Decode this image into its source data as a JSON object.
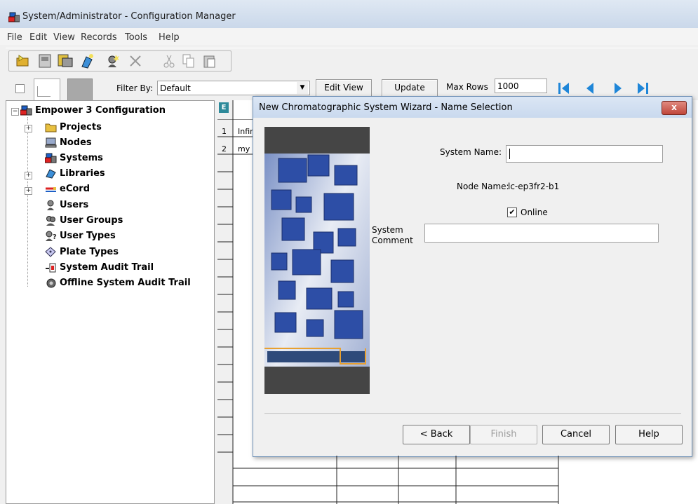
{
  "window": {
    "title": "System/Administrator - Configuration Manager"
  },
  "menu": [
    "File",
    "Edit",
    "View",
    "Records",
    "Tools",
    "Help"
  ],
  "filter_bar": {
    "filter_label": "Filter By:",
    "filter_value": "Default",
    "edit_view_label": "Edit View",
    "update_label": "Update",
    "max_rows_label": "Max Rows",
    "max_rows_value": "1000"
  },
  "tree": {
    "root": "Empower 3 Configuration",
    "items": [
      {
        "label": "Projects",
        "icon": "folder-icon"
      },
      {
        "label": "Nodes",
        "icon": "computer-icon"
      },
      {
        "label": "Systems",
        "icon": "systems-icon"
      },
      {
        "label": "Libraries",
        "icon": "libraries-icon"
      },
      {
        "label": "eCord",
        "icon": "ecord-icon"
      },
      {
        "label": "Users",
        "icon": "user-icon"
      },
      {
        "label": "User Groups",
        "icon": "user-groups-icon"
      },
      {
        "label": "User Types",
        "icon": "user-types-icon"
      },
      {
        "label": "Plate Types",
        "icon": "plate-icon"
      },
      {
        "label": "System Audit Trail",
        "icon": "audit-icon"
      },
      {
        "label": "Offline System Audit Trail",
        "icon": "offline-audit-icon"
      }
    ]
  },
  "grid": {
    "rows": [
      {
        "num": "1",
        "name": "Infir"
      },
      {
        "num": "2",
        "name": "my"
      }
    ]
  },
  "dialog": {
    "title": "New Chromatographic System Wizard - Name Selection",
    "system_name_label": "System Name:",
    "system_name_value": "",
    "node_name_label": "Node Name:",
    "node_name_value": "lc-ep3fr2-b1",
    "online_label": "Online",
    "online_checked": true,
    "comment_label_1": "System",
    "comment_label_2": "Comment",
    "back_label": "< Back",
    "finish_label": "Finish",
    "cancel_label": "Cancel",
    "help_label": "Help"
  },
  "colors": {
    "accent": "#2e4fa3",
    "dialog_close": "#c75050"
  }
}
